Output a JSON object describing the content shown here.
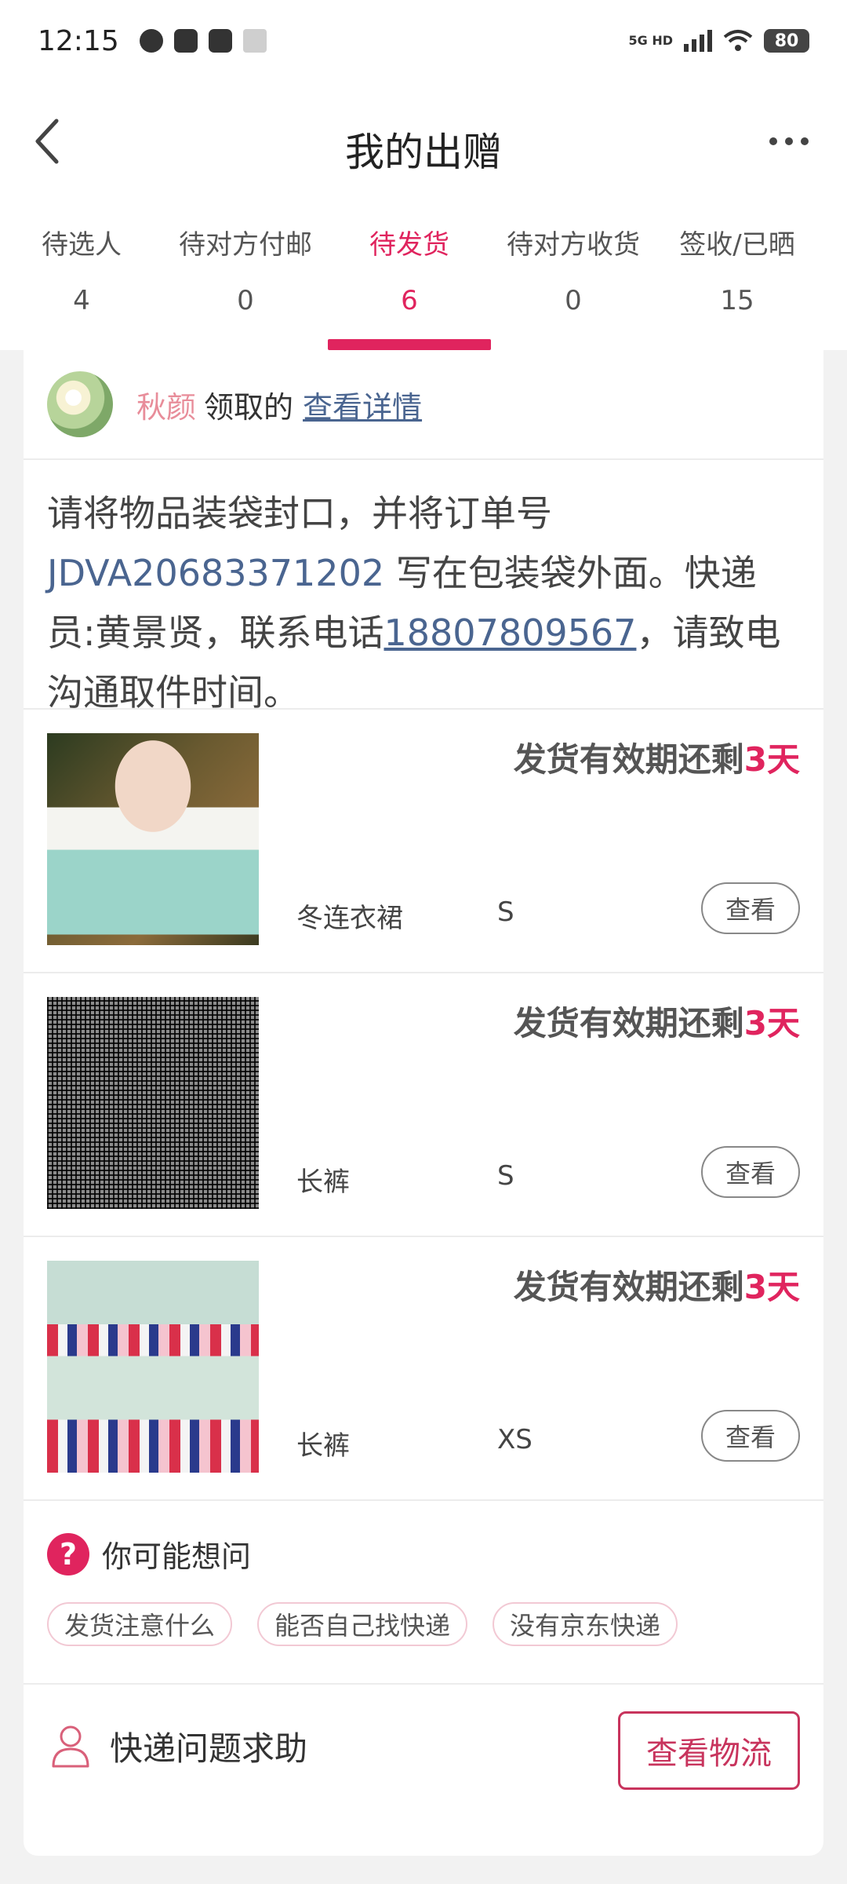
{
  "status_bar": {
    "time": "12:15",
    "network": "5G HD",
    "battery": "80"
  },
  "header": {
    "title": "我的出赠"
  },
  "tabs": [
    {
      "label": "待选人",
      "count": "4"
    },
    {
      "label": "待对方付邮",
      "count": "0"
    },
    {
      "label": "待发货",
      "count": "6",
      "active": true
    },
    {
      "label": "待对方收货",
      "count": "0"
    },
    {
      "label": "签收/已晒",
      "count": "15"
    }
  ],
  "receiver": {
    "name": "秋颜",
    "text": "领取的",
    "link": "查看详情"
  },
  "instruction": {
    "part1": "请将物品装袋封口，并将订单号 ",
    "order_no": "JDVA20683371202",
    "part2": " 写在包装袋外面。快递员:黄景贤，联系电话",
    "phone": "18807809567",
    "part3": "，请致电沟通取件时间。"
  },
  "items": [
    {
      "name": "冬连衣裙",
      "size": "S",
      "deadline_prefix": "发货有效期还剩",
      "days": "3天",
      "button": "查看"
    },
    {
      "name": "长裤",
      "size": "S",
      "deadline_prefix": "发货有效期还剩",
      "days": "3天",
      "button": "查看"
    },
    {
      "name": "长裤",
      "size": "XS",
      "deadline_prefix": "发货有效期还剩",
      "days": "3天",
      "button": "查看"
    }
  ],
  "faq": {
    "title": "你可能想问",
    "chips": [
      "发货注意什么",
      "能否自己找快递",
      "没有京东快递"
    ]
  },
  "help": {
    "label": "快递问题求助",
    "button": "查看物流"
  },
  "colors": {
    "accent": "#e0245e",
    "link": "#4a6590"
  }
}
